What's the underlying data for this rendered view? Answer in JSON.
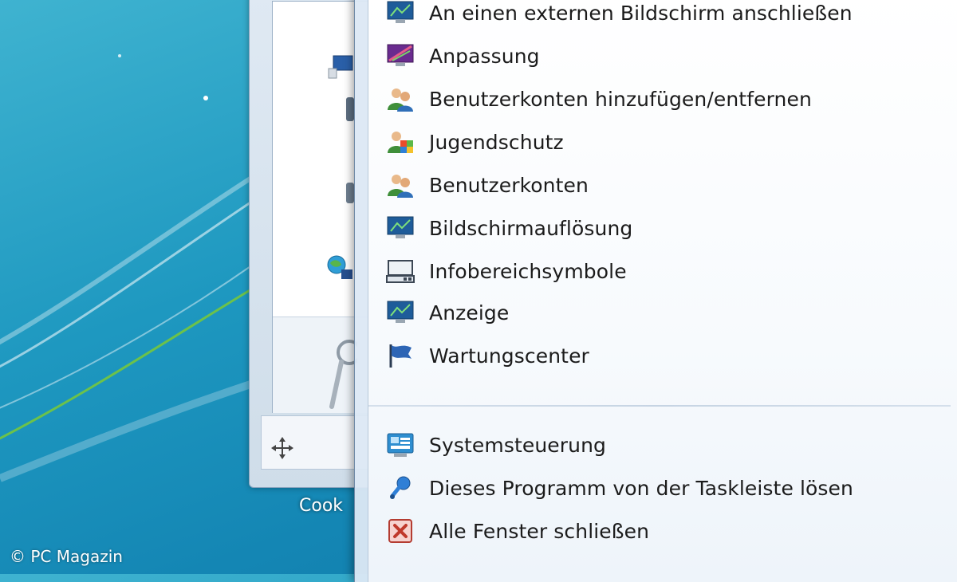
{
  "watermark": "© PC Magazin",
  "background_window": {
    "caption": "Cook"
  },
  "jumplist": {
    "tasks": [
      {
        "label": "An einen externen Bildschirm anschließen",
        "icon": "monitor-icon"
      },
      {
        "label": "Anpassung",
        "icon": "personalization-icon"
      },
      {
        "label": "Benutzerkonten hinzufügen/entfernen",
        "icon": "users-icon"
      },
      {
        "label": "Jugendschutz",
        "icon": "parental-control-icon"
      },
      {
        "label": "Benutzerkonten",
        "icon": "users-icon"
      },
      {
        "label": "Bildschirmauflösung",
        "icon": "monitor-icon"
      },
      {
        "label": "Infobereichsymbole",
        "icon": "notification-area-icon"
      },
      {
        "label": "Anzeige",
        "icon": "monitor-icon"
      },
      {
        "label": "Wartungscenter",
        "icon": "flag-icon"
      }
    ],
    "program_items": [
      {
        "label": "Systemsteuerung",
        "icon": "control-panel-icon"
      },
      {
        "label": "Dieses Programm von der Taskleiste lösen",
        "icon": "unpin-icon"
      },
      {
        "label": "Alle Fenster schließen",
        "icon": "close-window-icon"
      }
    ]
  }
}
